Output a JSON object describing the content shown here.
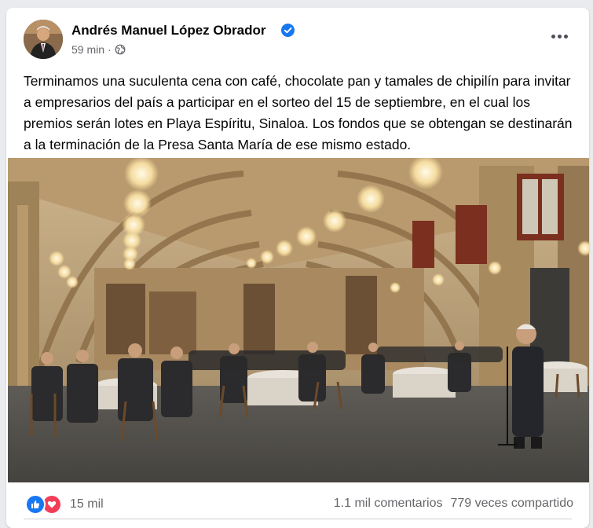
{
  "post": {
    "author": "Andrés Manuel López Obrador",
    "verified": true,
    "timestamp": "59 min",
    "separator": "·",
    "audience_icon": "globe-icon",
    "more_icon": "more-options-icon",
    "text": "Terminamos una suculenta cena con café, chocolate pan y tamales de chipilín para invitar a empresarios del país a participar en el sorteo del 15 de septiembre, en el cual los premios serán lotes en Playa Espíritu, Sinaloa. Los fondos que se obtengan se destinarán a la terminación de la Presa Santa María de ese mismo estado."
  },
  "stats": {
    "reactions": [
      "like",
      "love"
    ],
    "reaction_count": "15 mil",
    "comments": "1.1 mil comentarios",
    "shares": "779 veces compartido"
  },
  "colors": {
    "verified_blue": "#1877f2",
    "like_blue": "#1877f2",
    "love_red": "#f33e58",
    "secondary_text": "#65676b"
  }
}
